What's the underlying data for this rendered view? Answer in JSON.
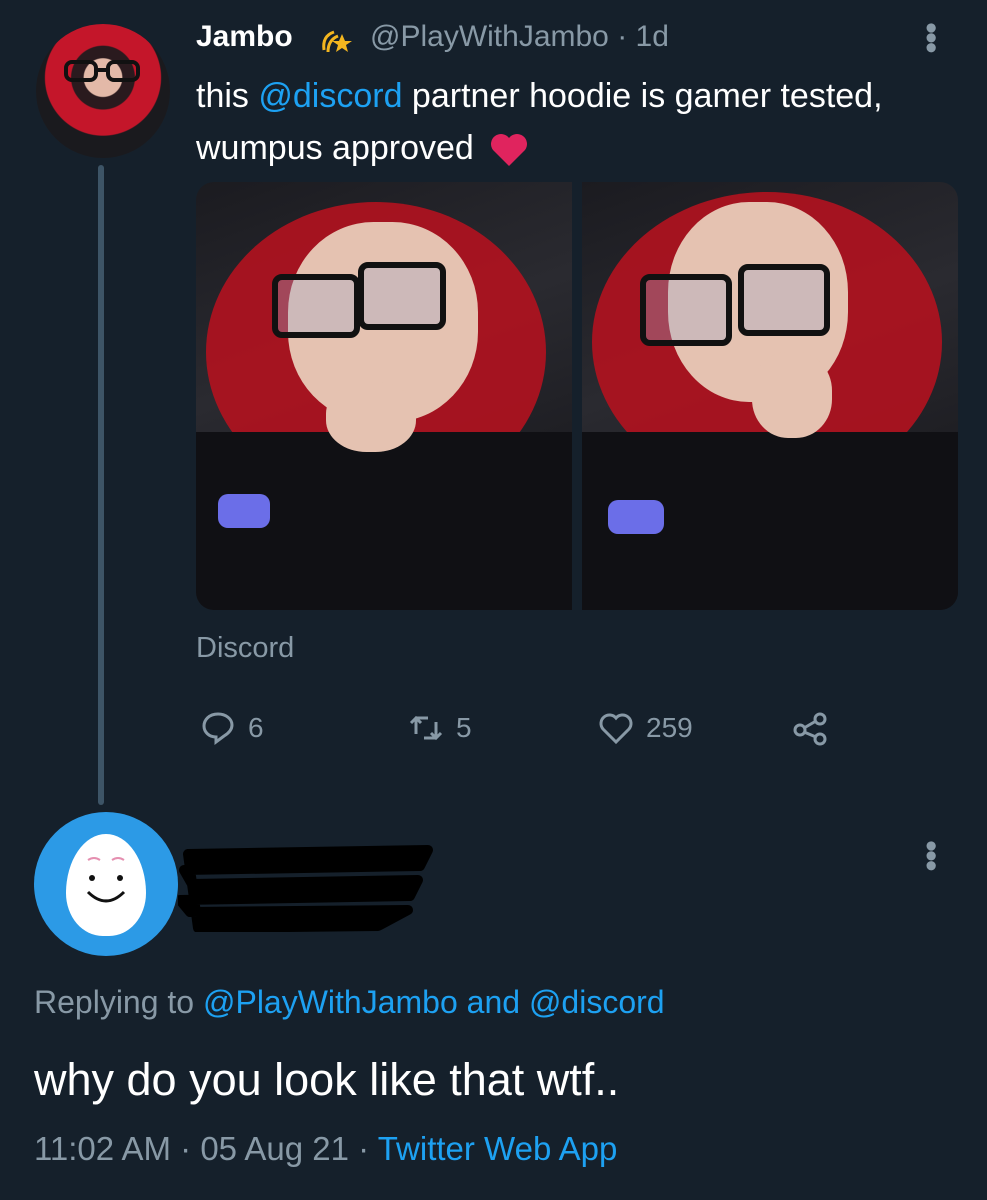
{
  "tweet": {
    "author_name": "Jambo",
    "author_handle": "@PlayWithJambo",
    "age": "· 1d",
    "text_before": "this ",
    "mention": "@discord",
    "text_after": " partner hoodie is gamer tested, wumpus approved",
    "source": "Discord",
    "replies": "6",
    "retweets": "5",
    "likes": "259"
  },
  "reply": {
    "replying_prefix": "Replying to ",
    "replying_to_1": "@PlayWithJambo",
    "replying_and": " and ",
    "replying_to_2": "@discord",
    "text": "why do you look like that wtf..",
    "time": "11:02 AM",
    "date": "05 Aug 21",
    "client": "Twitter Web App",
    "sep": " · "
  },
  "colors": {
    "background": "#15202b",
    "accent": "#1da1f2",
    "muted": "#8899a6",
    "heart": "#e0245e"
  }
}
